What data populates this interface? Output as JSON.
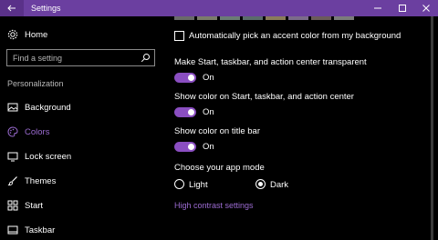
{
  "window": {
    "title": "Settings"
  },
  "sidebar": {
    "home_label": "Home",
    "search_placeholder": "Find a setting",
    "section_heading": "Personalization",
    "items": [
      {
        "label": "Background",
        "icon": "image-icon"
      },
      {
        "label": "Colors",
        "icon": "palette-icon",
        "selected": true
      },
      {
        "label": "Lock screen",
        "icon": "lock-screen-icon"
      },
      {
        "label": "Themes",
        "icon": "brush-icon"
      },
      {
        "label": "Start",
        "icon": "start-grid-icon"
      },
      {
        "label": "Taskbar",
        "icon": "taskbar-icon"
      }
    ]
  },
  "colors": {
    "accent": "#8a4ec1",
    "titlebar": "#6b3fa0",
    "link": "#9b6bd1",
    "swatches": [
      "#6a6a6a",
      "#7b7b6b",
      "#6b7b75",
      "#5b6b6b",
      "#8a7b5b",
      "#7b6b8a",
      "#6b5b5b",
      "#7b7b7b"
    ]
  },
  "main": {
    "auto_accent_label": "Automatically pick an accent color from my background",
    "auto_accent_checked": false,
    "transparent_label": "Make Start, taskbar, and action center transparent",
    "transparent_state": "On",
    "color_start_label": "Show color on Start, taskbar, and action center",
    "color_start_state": "On",
    "color_titlebar_label": "Show color on title bar",
    "color_titlebar_state": "On",
    "app_mode_label": "Choose your app mode",
    "mode_light": "Light",
    "mode_dark": "Dark",
    "mode_selected": "Dark",
    "high_contrast_link": "High contrast settings"
  }
}
